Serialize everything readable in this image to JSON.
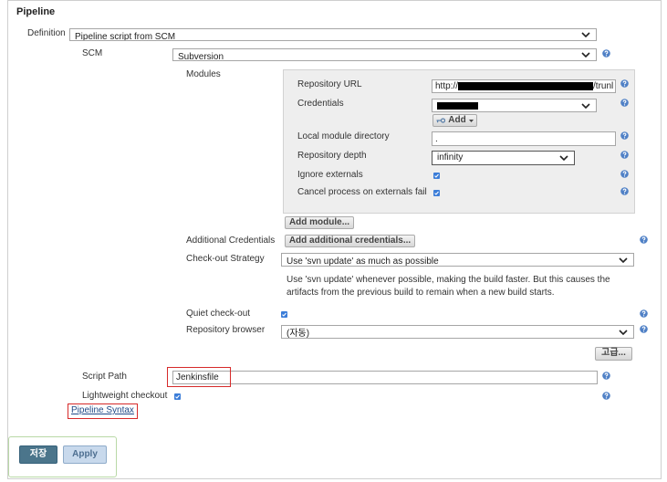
{
  "section": {
    "title": "Pipeline"
  },
  "definition": {
    "label": "Definition",
    "value": "Pipeline script from SCM"
  },
  "scm": {
    "label": "SCM",
    "value": "Subversion"
  },
  "modules": {
    "label": "Modules",
    "repository_url": {
      "label": "Repository URL",
      "value_start": "http://",
      "value_end": "/trunl"
    },
    "credentials": {
      "label": "Credentials",
      "add_button": "Add"
    },
    "local_module_directory": {
      "label": "Local module directory",
      "value": "."
    },
    "repository_depth": {
      "label": "Repository depth",
      "value": "infinity"
    },
    "ignore_externals": {
      "label": "Ignore externals",
      "checked": true
    },
    "cancel_process_on_externals_fail": {
      "label": "Cancel process on externals fail",
      "checked": true
    },
    "add_module_button": "Add module..."
  },
  "additional_credentials": {
    "label": "Additional Credentials",
    "button": "Add additional credentials..."
  },
  "checkout_strategy": {
    "label": "Check-out Strategy",
    "value": "Use 'svn update' as much as possible",
    "description": "Use 'svn update' whenever possible, making the build faster. But this causes the artifacts from the previous build to remain when a new build starts."
  },
  "quiet_checkout": {
    "label": "Quiet check-out",
    "checked": true
  },
  "repository_browser": {
    "label": "Repository browser",
    "value": "(자동)"
  },
  "advanced_button": "고급...",
  "script_path": {
    "label": "Script Path",
    "value": "Jenkinsfile"
  },
  "lightweight_checkout": {
    "label": "Lightweight checkout",
    "checked": true
  },
  "pipeline_syntax_link": "Pipeline Syntax",
  "actions": {
    "save": "저장",
    "apply": "Apply"
  },
  "icons": {
    "help": "help-icon",
    "dropdown": "chevron-down-icon",
    "credentials_add": "key-icon",
    "add_menu": "caret-down-icon",
    "checkbox": "checkbox-checked-icon"
  },
  "colors": {
    "help_icon": "#4f80c6",
    "checkbox": "#3b7dd8",
    "save_button": "#4b758b",
    "apply_button": "#c8d9ec",
    "highlight": "#d62a2a",
    "module_panel": "#eeeeee",
    "link": "#204a87",
    "button_bar_border": "#b9d9a6"
  }
}
